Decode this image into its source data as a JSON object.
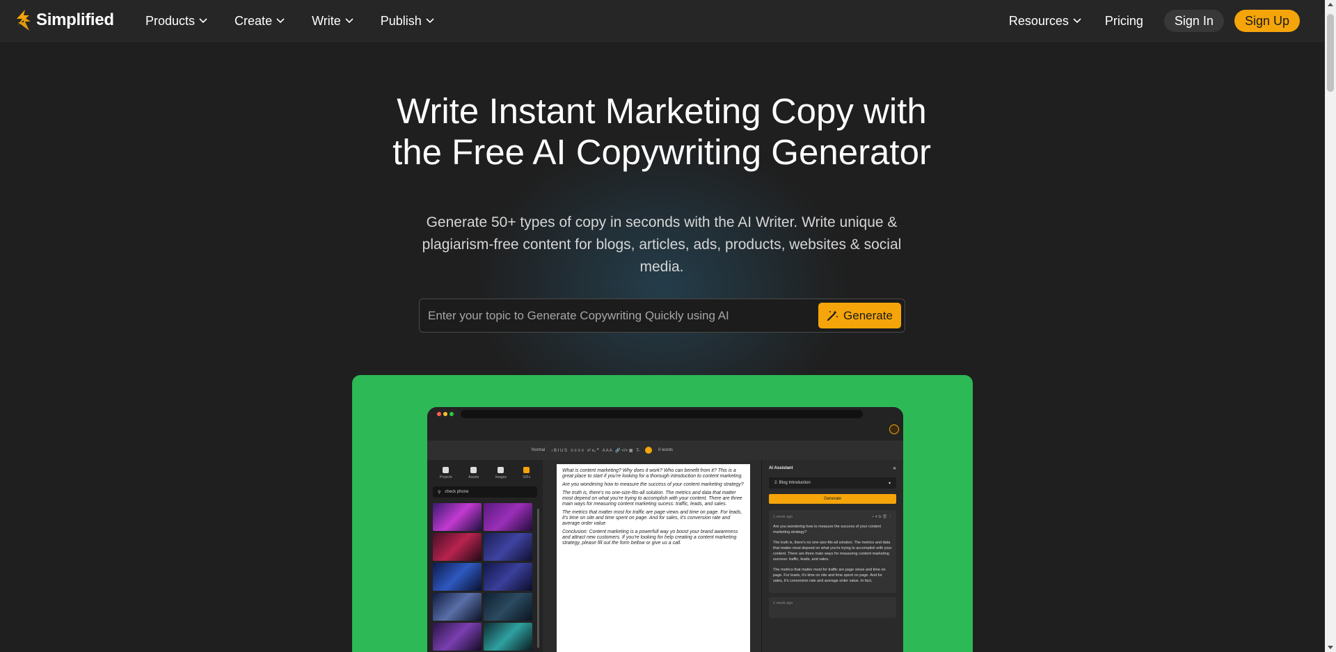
{
  "brand": {
    "name": "Simplified",
    "accent": "#f5a50a",
    "green": "#2db955"
  },
  "nav": {
    "left_items": [
      {
        "label": "Products"
      },
      {
        "label": "Create"
      },
      {
        "label": "Write"
      },
      {
        "label": "Publish"
      }
    ],
    "resources_label": "Resources",
    "pricing_label": "Pricing",
    "signin_label": "Sign In",
    "signup_label": "Sign Up"
  },
  "hero": {
    "title": "Write Instant Marketing Copy with the Free AI Copywriting Generator",
    "subtitle": "Generate 50+ types of copy in seconds with the AI Writer. Write unique & plagiarism-free content for blogs, articles, ads, products, websites & social media.",
    "search_placeholder": "Enter your topic to Generate Copywriting Quickly using AI",
    "generate_label": "Generate"
  },
  "mockup": {
    "toolbar": {
      "style_label": "Normal",
      "words_label": "0 words"
    },
    "left_tabs": [
      "Projects",
      "Assets",
      "Images",
      "GIFs"
    ],
    "search_value": "check phone",
    "document_paragraphs": [
      "What is content marketing? Why does it work? Who can benefit from it? This is a great place to start if you're looking for a thorough introduction to content marketing.",
      "Are you wondering how to measure the success of your content marketing strategy?",
      "The truth is, there's no one-size-fits-all solution. The metrics and data that matter most depend on what you're trying to accomplish with your content. There are three main ways for measuring content marketing sucess: traffic, leads, and sales.",
      "The metrics that matter most for traffic are page views and time on page. For leads, it's time on site and time spent on page. And for sales, it's conversion rate and average order value",
      "Conclusion: Content marketing is a powerfull way yo boost your brand awareness and attract new customers. If you're looking for help creating a content marketing strategy, please fill out the form bellow or give us a call."
    ],
    "ai": {
      "title": "AI Assistant",
      "close": "✕",
      "selected_template": "2. Blog Introduction",
      "generate_label": "Generate",
      "card_time": "1 week ago",
      "card_paragraphs": [
        "Are you wondering how to measure the success of your content marketing strategy?",
        "The truth is, there's no one-size-fits-all solution. The metrics and data that matter most depend on what you're trying to accomplish with your content. There are three main ways for measuring content marketing success: traffic, leads, and sales.",
        "The metrics that matter most for traffic are page views and time on page. For leads, it's time on site and time spent on page. And for sales, it's conversion rate and average order value. In fact,"
      ],
      "card2_time": "1 week ago"
    }
  }
}
